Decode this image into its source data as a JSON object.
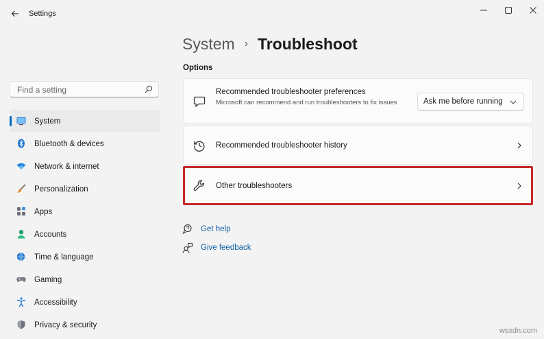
{
  "app": {
    "title": "Settings"
  },
  "search": {
    "placeholder": "Find a setting"
  },
  "sidebar": {
    "items": [
      {
        "label": "System",
        "icon": "monitor-icon",
        "active": true
      },
      {
        "label": "Bluetooth & devices",
        "icon": "bluetooth-icon"
      },
      {
        "label": "Network & internet",
        "icon": "wifi-icon"
      },
      {
        "label": "Personalization",
        "icon": "brush-icon"
      },
      {
        "label": "Apps",
        "icon": "apps-icon"
      },
      {
        "label": "Accounts",
        "icon": "person-icon"
      },
      {
        "label": "Time & language",
        "icon": "globe-clock-icon"
      },
      {
        "label": "Gaming",
        "icon": "gamepad-icon"
      },
      {
        "label": "Accessibility",
        "icon": "accessibility-icon"
      },
      {
        "label": "Privacy & security",
        "icon": "shield-icon"
      }
    ]
  },
  "breadcrumb": {
    "parent": "System",
    "separator": "›",
    "current": "Troubleshoot"
  },
  "main": {
    "section_title": "Options",
    "cards": [
      {
        "title": "Recommended troubleshooter preferences",
        "description": "Microsoft can recommend and run troubleshooters to fix issues",
        "icon": "chat-bubble-icon",
        "dropdown_value": "Ask me before running"
      },
      {
        "title": "Recommended troubleshooter history",
        "icon": "history-icon"
      },
      {
        "title": "Other troubleshooters",
        "icon": "wrench-icon",
        "highlighted": true
      }
    ],
    "links": [
      {
        "label": "Get help",
        "icon": "help-icon"
      },
      {
        "label": "Give feedback",
        "icon": "feedback-icon"
      }
    ]
  },
  "watermark": "wsxdn.com",
  "colors": {
    "accent": "#0067c0",
    "highlight_border": "#c62828",
    "link": "#0b5fa5"
  }
}
